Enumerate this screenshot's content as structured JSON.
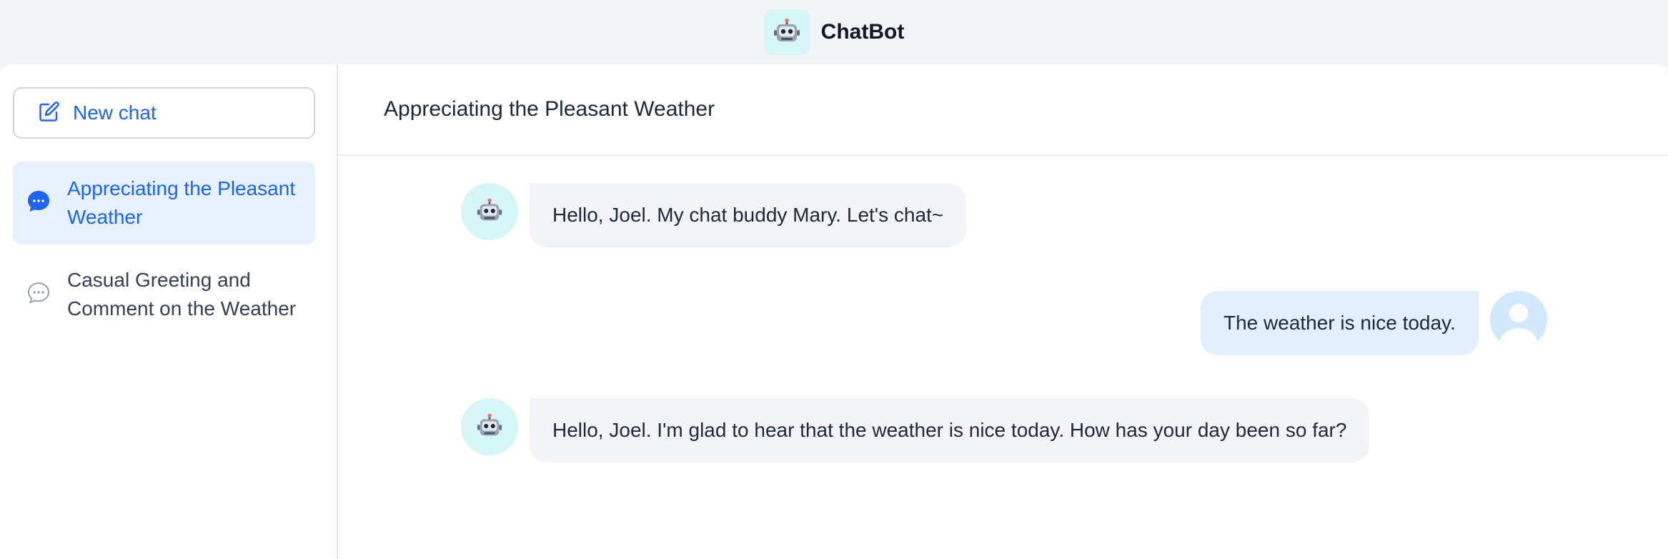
{
  "app": {
    "name": "ChatBot",
    "logo_icon": "robot-icon"
  },
  "sidebar": {
    "new_chat_label": "New chat",
    "conversations": [
      {
        "label": "Appreciating the Pleasant Weather",
        "active": true
      },
      {
        "label": "Casual Greeting and Comment on the Weather",
        "active": false
      }
    ]
  },
  "conversation": {
    "title": "Appreciating the Pleasant Weather",
    "messages": [
      {
        "role": "bot",
        "text": "Hello, Joel. My chat buddy Mary. Let's chat~"
      },
      {
        "role": "user",
        "text": "The weather is nice today."
      },
      {
        "role": "bot",
        "text": "Hello, Joel. I'm glad to hear that the weather is nice today. How has your day been so far?"
      }
    ]
  },
  "colors": {
    "accent": "#1c64f2",
    "active_item_bg": "#e6f0fe",
    "bot_bubble": "#f2f4f7",
    "user_bubble": "#e1effe",
    "bot_avatar_bg": "#d5f5f6"
  }
}
